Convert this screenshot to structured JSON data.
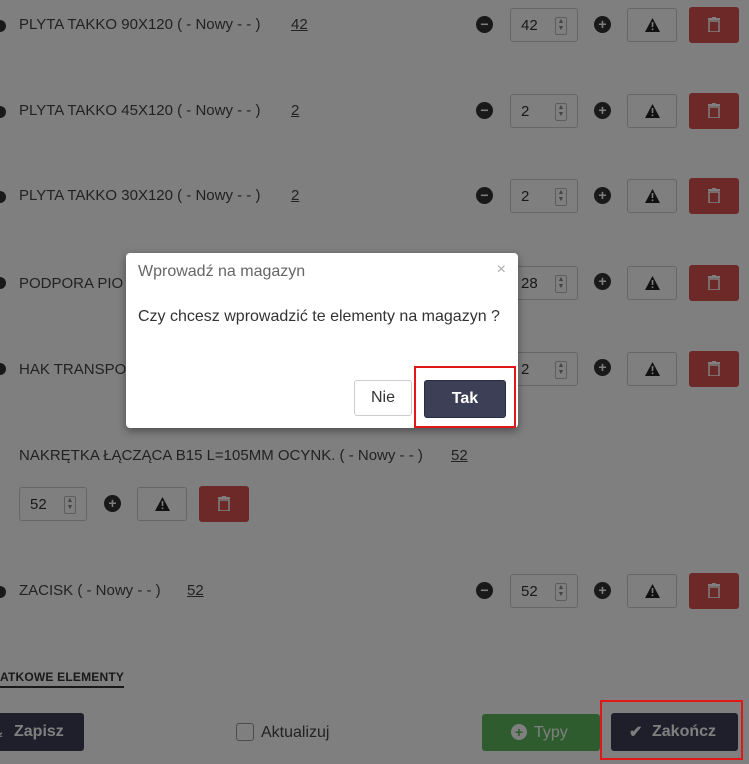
{
  "items": [
    {
      "label": "PLYTA TAKKO 90X120 ( - Nowy - - )",
      "qty": "42",
      "value": "42"
    },
    {
      "label": "PLYTA TAKKO 45X120 ( - Nowy - - )",
      "qty": "2",
      "value": "2"
    },
    {
      "label": "PLYTA TAKKO 30X120 ( - Nowy - - )",
      "qty": "2",
      "value": "2"
    },
    {
      "label": "PODPORA PIO",
      "value": "28"
    },
    {
      "label": "HAK TRANSPO",
      "value": "2"
    },
    {
      "label": "NAKRĘTKA ŁĄCZĄCA B15 L=105MM OCYNK. ( - Nowy - - )",
      "qty": "52",
      "value": "52"
    },
    {
      "label": "ZACISK ( - Nowy - - )",
      "qty": "52",
      "value": "52"
    }
  ],
  "section": {
    "title": "ATKOWE ELEMENTY"
  },
  "footer": {
    "save_label": "Zapisz",
    "update_label": "Aktualizuj",
    "types_label": "Typy",
    "finish_label": "Zakończ"
  },
  "modal": {
    "title": "Wprowadź na magazyn",
    "close": "×",
    "message": "Czy chcesz wprowadzić te elementy na magazyn ?",
    "no_label": "Nie",
    "yes_label": "Tak"
  },
  "colors": {
    "accent": "#3c3f55",
    "danger": "#d9534f",
    "success": "#5cb85c",
    "highlight": "#e01818"
  },
  "icons": [
    "minus-circle-icon",
    "plus-circle-icon",
    "warning-icon",
    "trash-icon",
    "check-icon",
    "download-icon",
    "close-icon"
  ]
}
